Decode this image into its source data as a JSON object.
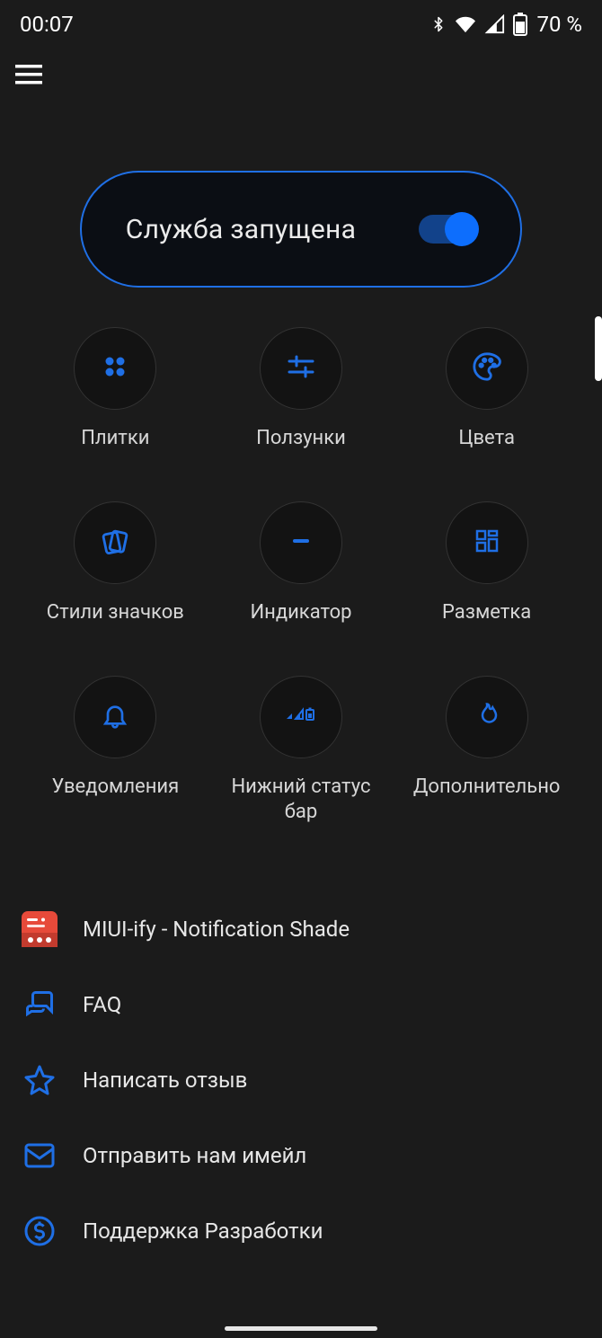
{
  "statusbar": {
    "time": "00:07",
    "battery_text": "70 %"
  },
  "toggle": {
    "label": "Служба запущена",
    "state": "on"
  },
  "grid": [
    {
      "id": "tiles",
      "label": "Плитки"
    },
    {
      "id": "sliders",
      "label": "Ползунки"
    },
    {
      "id": "colors",
      "label": "Цвета"
    },
    {
      "id": "iconstyles",
      "label": "Стили значков"
    },
    {
      "id": "indicator",
      "label": "Индикатор"
    },
    {
      "id": "layout",
      "label": "Разметка"
    },
    {
      "id": "notifications",
      "label": "Уведомления"
    },
    {
      "id": "bottomstatus",
      "label": "Нижний статус бар"
    },
    {
      "id": "extras",
      "label": "Дополнительно"
    }
  ],
  "actions": [
    {
      "id": "miuiify",
      "label": "MIUI-ify - Notification Shade"
    },
    {
      "id": "faq",
      "label": "FAQ"
    },
    {
      "id": "review",
      "label": "Написать отзыв"
    },
    {
      "id": "email",
      "label": "Отправить нам имейл"
    },
    {
      "id": "support",
      "label": "Поддержка Разработки"
    }
  ],
  "accent": "#1f6fe5"
}
